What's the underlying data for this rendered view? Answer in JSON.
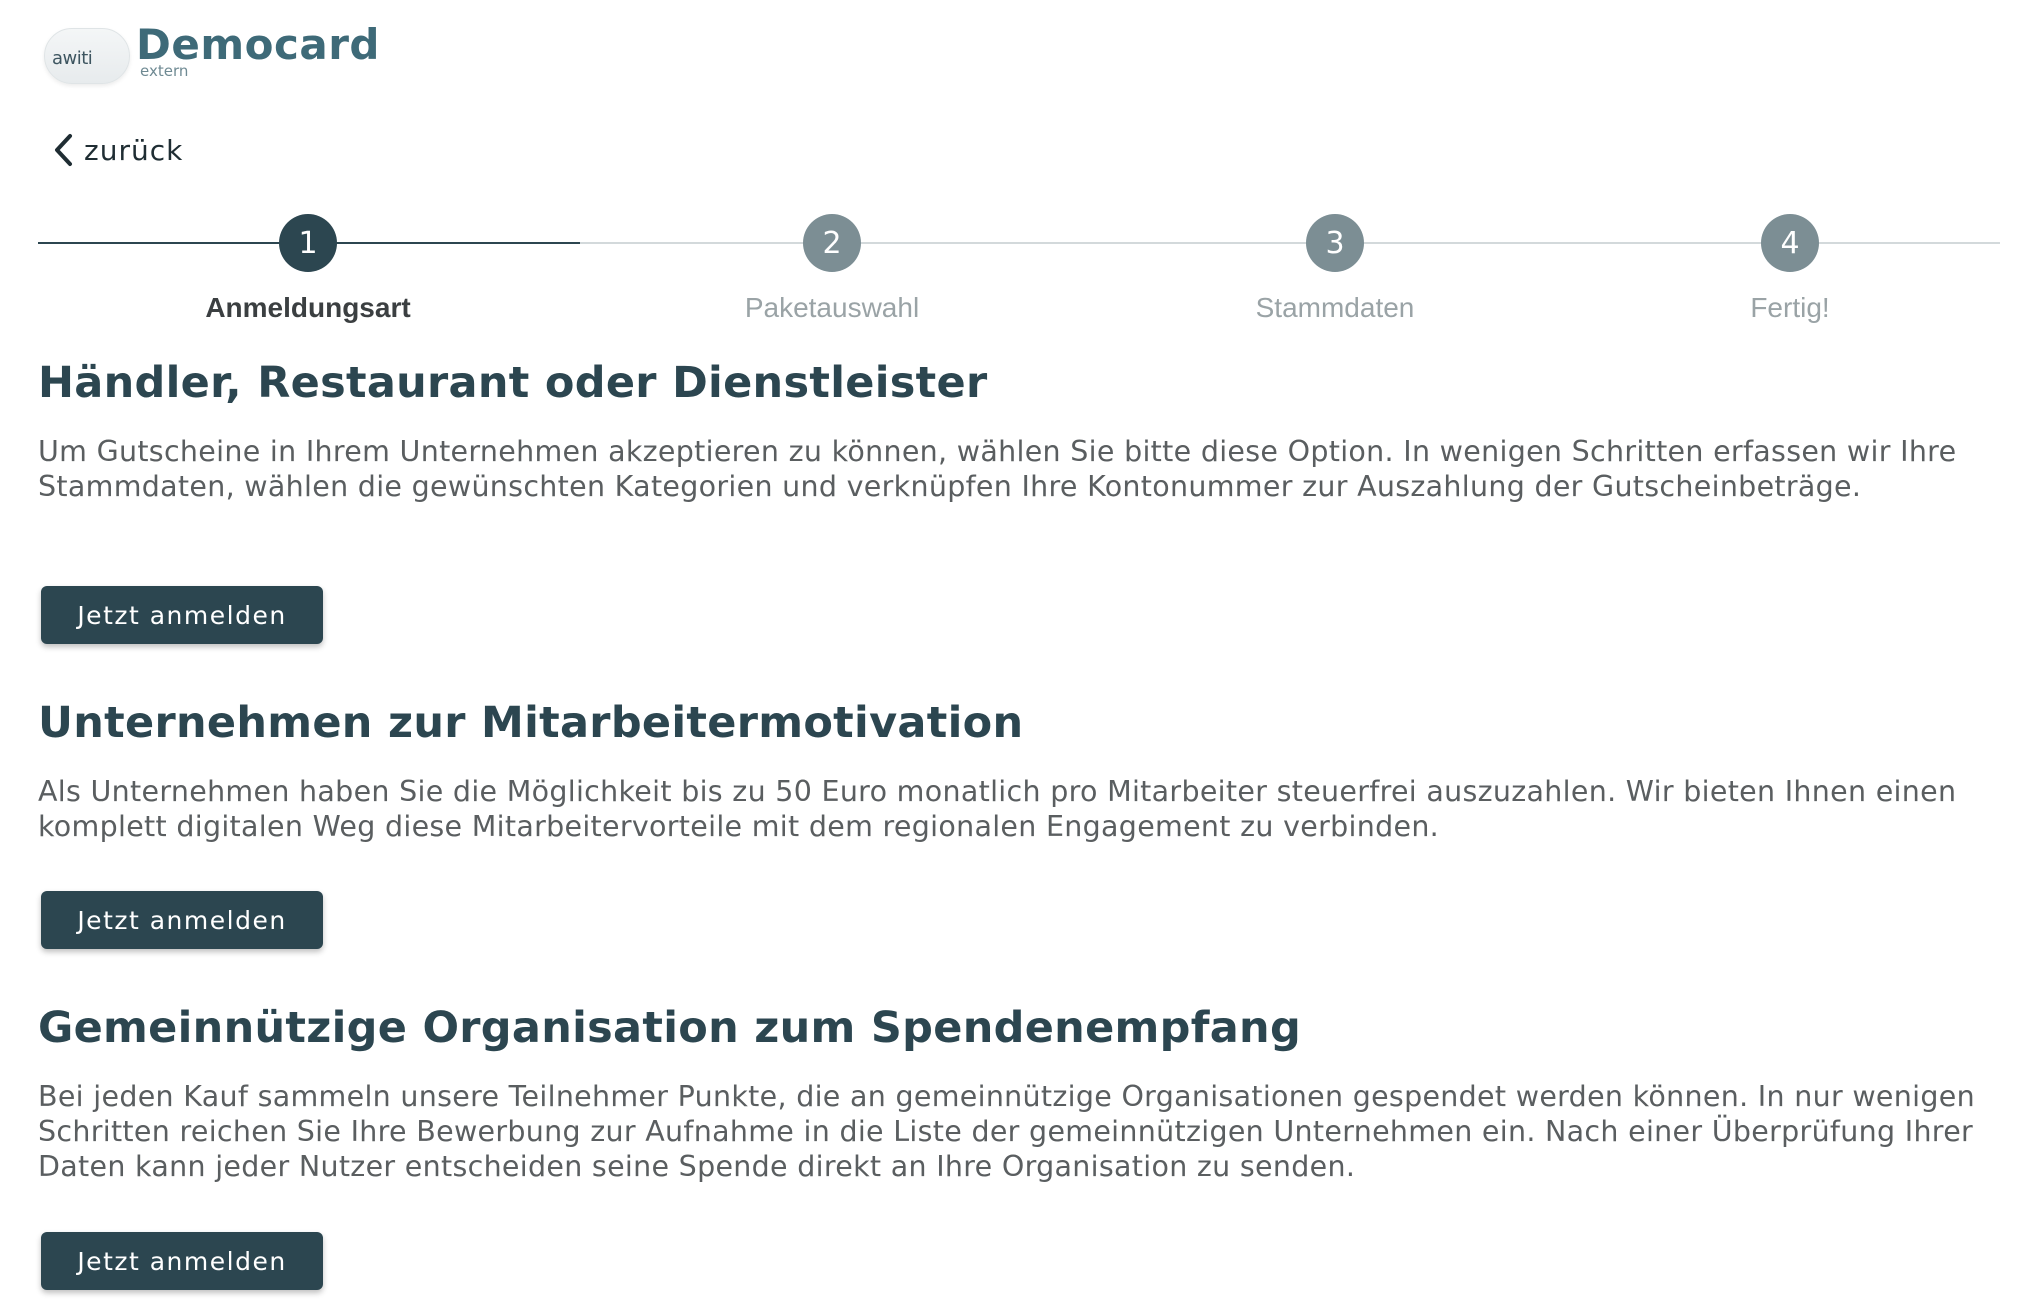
{
  "logo": {
    "brand": "awiti",
    "title": "Democard",
    "subtitle": "extern"
  },
  "back": {
    "label": "zurück"
  },
  "stepper": {
    "steps": [
      {
        "number": "1",
        "label": "Anmeldungsart",
        "active": true
      },
      {
        "number": "2",
        "label": "Paketauswahl",
        "active": false
      },
      {
        "number": "3",
        "label": "Stammdaten",
        "active": false
      },
      {
        "number": "4",
        "label": "Fertig!",
        "active": false
      }
    ]
  },
  "sections": [
    {
      "title": "Händler, Restaurant oder Dienstleister",
      "text": "Um Gutscheine in Ihrem Unternehmen akzeptieren zu können, wählen Sie bitte diese Option. In wenigen Schritten erfassen wir Ihre Stammdaten, wählen die gewünschten Kategorien und verknüpfen Ihre Kontonummer zur Auszahlung der Gutscheinbeträge.",
      "button": "Jetzt anmelden"
    },
    {
      "title": "Unternehmen zur Mitarbeitermotivation",
      "text": "Als Unternehmen haben Sie die Möglichkeit bis zu 50 Euro monatlich pro Mitarbeiter steuerfrei auszuzahlen. Wir bieten Ihnen einen komplett digitalen Weg diese Mitarbeitervorteile mit dem regionalen Engagement zu verbinden.",
      "button": "Jetzt anmelden"
    },
    {
      "title": "Gemeinnützige Organisation zum Spendenempfang",
      "text": "Bei jeden Kauf sammeln unsere Teilnehmer Punkte, die an gemeinnützige Organisationen gespendet werden können. In nur wenigen Schritten reichen Sie Ihre Bewerbung zur Aufnahme in die Liste der gemeinnützigen Unternehmen ein. Nach einer Überprüfung Ihrer Daten kann jeder Nutzer entscheiden seine Spende direkt an Ihre Organisation zu senden.",
      "button": "Jetzt anmelden"
    }
  ],
  "colors": {
    "primary": "#2c4650",
    "logo": "#3e6a78",
    "inactive_step": "#7c8e94"
  }
}
